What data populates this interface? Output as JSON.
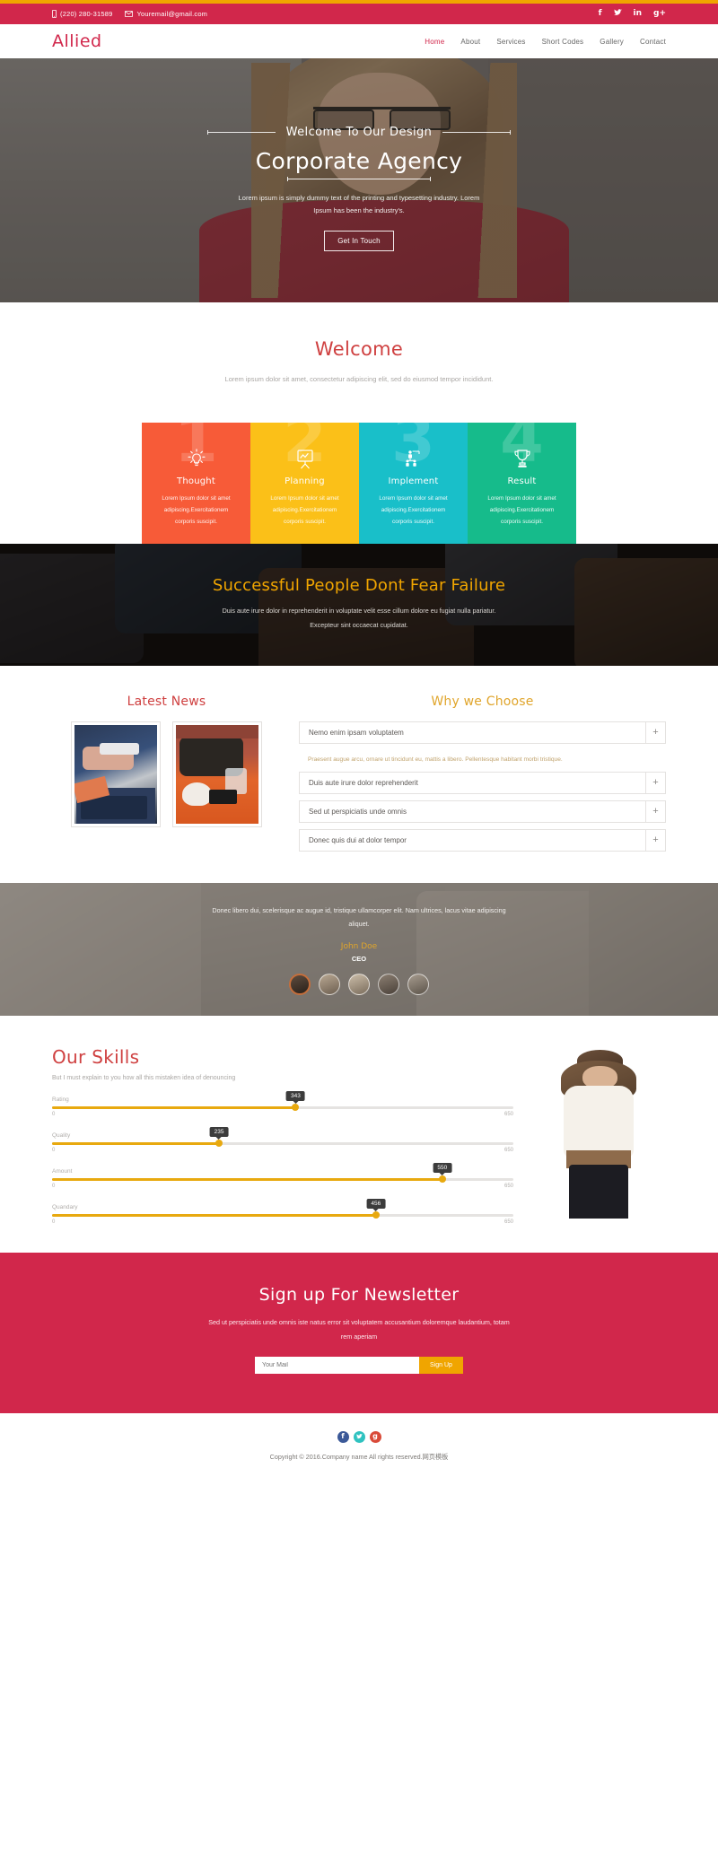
{
  "topbar": {
    "phone": "(220) 280-31589",
    "email": "Youremail@gmail.com",
    "phone_icon": "mobile-icon",
    "email_icon": "envelope-icon",
    "socials": [
      {
        "name": "facebook-icon",
        "glyph": "f"
      },
      {
        "name": "twitter-icon",
        "glyph": "ᵛ"
      },
      {
        "name": "linkedin-icon",
        "glyph": "in"
      },
      {
        "name": "googleplus-icon",
        "glyph": "g+"
      }
    ]
  },
  "nav": {
    "logo": "Allied",
    "items": [
      {
        "label": "Home",
        "active": true
      },
      {
        "label": "About",
        "active": false
      },
      {
        "label": "Services",
        "active": false
      },
      {
        "label": "Short Codes",
        "active": false
      },
      {
        "label": "Gallery",
        "active": false
      },
      {
        "label": "Contact",
        "active": false
      }
    ]
  },
  "hero": {
    "kicker": "Welcome To Our Design",
    "title": "Corporate Agency",
    "description": "Lorem ipsum is simply dummy text of the printing and typesetting industry. Lorem Ipsum has been the industry's.",
    "cta": "Get In Touch"
  },
  "welcome": {
    "title": "Welcome",
    "subtitle": "Lorem ipsum dolor sit amet, consectetur adipiscing elit, sed do eiusmod tempor incididunt."
  },
  "cards": [
    {
      "number": "1",
      "title": "Thought",
      "text": "Lorem Ipsum dolor sit amet adipiscing.Exercitationem corporis suscipit.",
      "color": "#f75b38",
      "icon": "lightbulb-icon"
    },
    {
      "number": "2",
      "title": "Planning",
      "text": "Lorem Ipsum dolor sit amet adipiscing.Exercitationem corporis suscipit.",
      "color": "#fbc018",
      "icon": "easel-board-icon"
    },
    {
      "number": "3",
      "title": "Implement",
      "text": "Lorem Ipsum dolor sit amet adipiscing.Exercitationem corporis suscipit.",
      "color": "#19bfc9",
      "icon": "org-chart-icon"
    },
    {
      "number": "4",
      "title": "Result",
      "text": "Lorem Ipsum dolor sit amet adipiscing.Exercitationem corporis suscipit.",
      "color": "#16bb8b",
      "icon": "trophy-icon"
    }
  ],
  "banner": {
    "title": "Successful People Dont Fear Failure",
    "text": "Duis aute irure dolor in reprehenderit in voluptate velit esse cillum dolore eu fugiat nulla pariatur. Excepteur sint occaecat cupidatat."
  },
  "news": {
    "title": "Latest News"
  },
  "why": {
    "title": "Why we Choose",
    "items": [
      {
        "label": "Nemo enim ipsam voluptatem",
        "toggle": "+",
        "open": true,
        "body": "Praesent augue arcu, ornare ut tincidunt eu, mattis a libero. Pellentesque habitant morbi tristique."
      },
      {
        "label": "Duis aute irure dolor reprehenderit",
        "toggle": "+",
        "open": false,
        "body": ""
      },
      {
        "label": "Sed ut perspiciatis unde omnis",
        "toggle": "+",
        "open": false,
        "body": ""
      },
      {
        "label": "Donec quis dui at dolor tempor",
        "toggle": "+",
        "open": false,
        "body": ""
      }
    ]
  },
  "testimonial": {
    "quote": "Donec libero dui, scelerisque ac augue id, tristique ullamcorper elit. Nam ultrices, lacus vitae adipiscing aliquet.",
    "name": "John Doe",
    "role": "CEO",
    "avatars": [
      "avatar-1",
      "avatar-2",
      "avatar-3",
      "avatar-4",
      "avatar-5"
    ]
  },
  "skills": {
    "title": "Our Skills",
    "lead": "But I must explain to you how all this mistaken idea of denouncing",
    "sliders": [
      {
        "label": "Rating",
        "value": "343",
        "min": "0",
        "max": "650"
      },
      {
        "label": "Quality",
        "value": "235",
        "min": "0",
        "max": "650"
      },
      {
        "label": "Amount",
        "value": "550",
        "min": "0",
        "max": "650"
      },
      {
        "label": "Quandary",
        "value": "456",
        "min": "0",
        "max": "650"
      }
    ]
  },
  "newsletter": {
    "title": "Sign up For Newsletter",
    "text": "Sed ut perspiciatis unde omnis iste natus error sit voluptatem accusantium doloremque laudantium, totam rem aperiam",
    "placeholder": "Your Mail",
    "button": "Sign Up"
  },
  "footer": {
    "socials": [
      {
        "name": "facebook-icon",
        "glyph": "f"
      },
      {
        "name": "twitter-icon",
        "glyph": "ᵛ"
      },
      {
        "name": "googleplus-icon",
        "glyph": "g"
      }
    ],
    "copyright": "Copyright © 2016.Company name All rights reserved.网页模板"
  },
  "chart_data": {
    "type": "bar",
    "title": "Our Skills",
    "categories": [
      "Rating",
      "Quality",
      "Amount",
      "Quandary"
    ],
    "values": [
      343,
      235,
      550,
      456
    ],
    "xlabel": "",
    "ylabel": "",
    "ylim": [
      0,
      650
    ]
  }
}
